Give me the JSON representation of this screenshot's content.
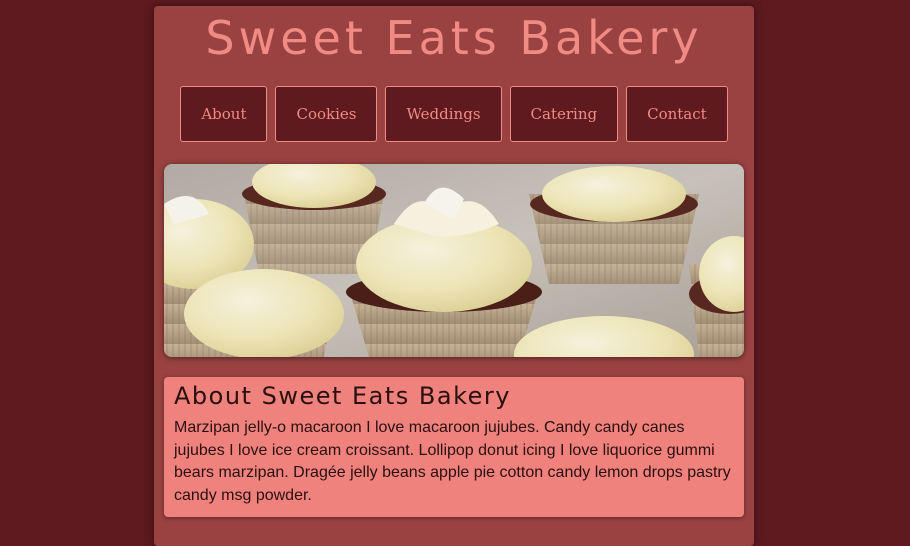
{
  "site": {
    "title": "Sweet Eats Bakery"
  },
  "nav": {
    "items": [
      {
        "label": "About"
      },
      {
        "label": "Cookies"
      },
      {
        "label": "Weddings"
      },
      {
        "label": "Catering"
      },
      {
        "label": "Contact"
      }
    ]
  },
  "hero": {
    "image": "cupcakes-photo"
  },
  "about": {
    "heading": "About Sweet Eats Bakery",
    "body": "Marzipan jelly-o macaroon I love macaroon jujubes. Candy candy canes jujubes I love ice cream croissant. Lollipop donut icing I love liquorice gummi bears marzipan. Dragée jelly beans apple pie cotton candy lemon drops pastry candy msg powder."
  },
  "colors": {
    "background": "#5e1a1e",
    "panel": "#9a4242",
    "accent": "#f08a84",
    "about_box": "#ef827c"
  }
}
